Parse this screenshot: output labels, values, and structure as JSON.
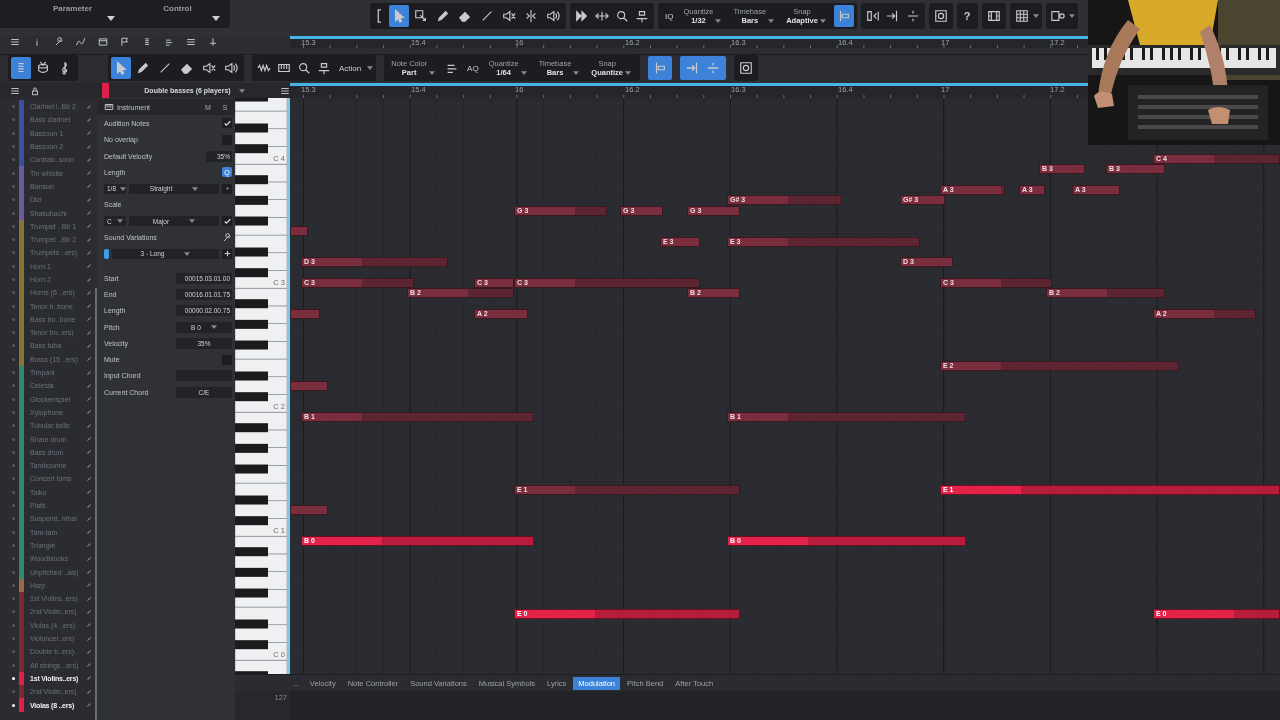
{
  "top_panel": {
    "parameter": "Parameter",
    "control": "Control"
  },
  "main_toolbar": {
    "tools": [
      {
        "selected": true
      },
      {
        "selected": false
      },
      {
        "selected": false
      },
      {
        "selected": false
      },
      {
        "selected": false
      },
      {
        "selected": false
      },
      {
        "selected": false
      },
      {
        "selected": false
      }
    ],
    "iq": "IQ",
    "quantize": {
      "label": "Quantize",
      "value": "1/32"
    },
    "timebase": {
      "label": "Timebase",
      "value": "Bars"
    },
    "snap": {
      "label": "Snap",
      "value": "Adaptive"
    },
    "snap_on": true,
    "help": "?"
  },
  "ruler_top": {
    "ticks": [
      "15.3",
      "15.4",
      "16",
      "16.2",
      "16.3",
      "16.4",
      "17",
      "17.2"
    ]
  },
  "editor_toolbar": {
    "views": [
      {
        "selected": true
      },
      {
        "selected": false
      },
      {
        "selected": false
      }
    ],
    "tools": [
      {
        "selected": true
      },
      {
        "selected": false
      },
      {
        "selected": false
      },
      {
        "selected": false
      },
      {
        "selected": false
      },
      {
        "selected": false
      }
    ],
    "action": "Action",
    "note_color": {
      "label": "Note Color",
      "value": "Part"
    },
    "aq": "AQ",
    "quantize": {
      "label": "Quantize",
      "value": "1/64"
    },
    "timebase": {
      "label": "Timebase",
      "value": "Bars"
    },
    "snap": {
      "label": "Snap",
      "value": "Quantize"
    },
    "snap_on": true,
    "step_on": true
  },
  "ruler": {
    "ticks": [
      "15.3",
      "15.4",
      "16",
      "16.2",
      "16.3",
      "16.4",
      "17",
      "17.2"
    ]
  },
  "tracks": [
    {
      "name": "Clarinet i..Bb 2",
      "color": "#3b4f9e",
      "selected": false
    },
    {
      "name": "Bass clarinet",
      "color": "#3b4f9e",
      "selected": false
    },
    {
      "name": "Bassoon 1",
      "color": "#3b4f9e",
      "selected": false
    },
    {
      "name": "Bassoon 2",
      "color": "#3b4f9e",
      "selected": false
    },
    {
      "name": "Contrab..soon",
      "color": "#3b4f9e",
      "selected": false
    },
    {
      "name": "Tin whistle",
      "color": "#6b5a9c",
      "selected": false
    },
    {
      "name": "Bansuri",
      "color": "#6b5a9c",
      "selected": false
    },
    {
      "name": "Dizi",
      "color": "#6b5a9c",
      "selected": false
    },
    {
      "name": "Shakuhachi",
      "color": "#6b5a9c",
      "selected": false
    },
    {
      "name": "Trumpet ..Bb 1",
      "color": "#857638",
      "selected": false
    },
    {
      "name": "Trumpet ..Bb 2",
      "color": "#857638",
      "selected": false
    },
    {
      "name": "Trumpets ..ers)",
      "color": "#857638",
      "selected": false
    },
    {
      "name": "Horn 1",
      "color": "#857638",
      "selected": false
    },
    {
      "name": "Horn 2",
      "color": "#857638",
      "selected": false
    },
    {
      "name": "Horns (6 ..ers)",
      "color": "#857638",
      "selected": false
    },
    {
      "name": "Tenor tr..bone",
      "color": "#857638",
      "selected": false
    },
    {
      "name": "Bass tro..bone",
      "color": "#857638",
      "selected": false
    },
    {
      "name": "Tenor tro..ers)",
      "color": "#857638",
      "selected": false
    },
    {
      "name": "Bass tuba",
      "color": "#857638",
      "selected": false
    },
    {
      "name": "Brass (15 ..ers)",
      "color": "#857638",
      "selected": false
    },
    {
      "name": "Timpani",
      "color": "#2e8a68",
      "selected": false
    },
    {
      "name": "Celesta",
      "color": "#2e8a68",
      "selected": false
    },
    {
      "name": "Glockenspiel",
      "color": "#2e8a68",
      "selected": false
    },
    {
      "name": "Xylophone",
      "color": "#2e8a68",
      "selected": false
    },
    {
      "name": "Tubular bells",
      "color": "#2e8a68",
      "selected": false
    },
    {
      "name": "Snare drum",
      "color": "#2e8a68",
      "selected": false
    },
    {
      "name": "Bass drum",
      "color": "#2e8a68",
      "selected": false
    },
    {
      "name": "Tambourine",
      "color": "#2e8a68",
      "selected": false
    },
    {
      "name": "Concert toms",
      "color": "#2e8a68",
      "selected": false
    },
    {
      "name": "Taiko",
      "color": "#2e8a68",
      "selected": false
    },
    {
      "name": "Piatti",
      "color": "#2e8a68",
      "selected": false
    },
    {
      "name": "Suspend..mbal",
      "color": "#2e8a68",
      "selected": false
    },
    {
      "name": "Tam-tam",
      "color": "#2e8a68",
      "selected": false
    },
    {
      "name": "Triangle",
      "color": "#2e8a68",
      "selected": false
    },
    {
      "name": "Woodblocks",
      "color": "#2e8a68",
      "selected": false
    },
    {
      "name": "Unpitched ..als)",
      "color": "#2e8a68",
      "selected": false
    },
    {
      "name": "Harp",
      "color": "#9a6a48",
      "selected": false
    },
    {
      "name": "1st Violins..ers)",
      "color": "#7c2537",
      "selected": false
    },
    {
      "name": "2nd Violin..ers)",
      "color": "#7c2537",
      "selected": false
    },
    {
      "name": "Violas (4 ..ers)",
      "color": "#7c2537",
      "selected": false
    },
    {
      "name": "Violoncel..ers)",
      "color": "#7c2537",
      "selected": false
    },
    {
      "name": "Double b..ers)",
      "color": "#7c2537",
      "selected": false
    },
    {
      "name": "All strings ..ers)",
      "color": "#7c2537",
      "selected": false
    },
    {
      "name": "1st Violins..ers)",
      "color": "#e01e4a",
      "selected": true
    },
    {
      "name": "2nd Violin..ers)",
      "color": "#7c2537",
      "selected": false
    },
    {
      "name": "Violas (8 ..ers)",
      "color": "#e01e4a",
      "selected": true
    }
  ],
  "inspector": {
    "title": "Double basses (6 players)",
    "instrument": {
      "label": "Instrument",
      "mute": "M",
      "solo": "S"
    },
    "audition": {
      "label": "Audition Notes",
      "checked": true
    },
    "no_overlap": {
      "label": "No overlap",
      "checked": false
    },
    "default_velocity": {
      "label": "Default Velocity",
      "value": "35%"
    },
    "length": {
      "label": "Length",
      "quantize_button": "Q",
      "quantize_on": true,
      "value": "1/8",
      "mode": "Straight"
    },
    "scale": {
      "label": "Scale",
      "root": "C",
      "type": "Major",
      "checked": true
    },
    "sound_variations": {
      "label": "Sound Variations",
      "value": "3 - Long"
    },
    "note_fields": [
      {
        "kind": "field",
        "label": "Start",
        "value": "00015.03.01.00"
      },
      {
        "kind": "field",
        "label": "End",
        "value": "00016.01.01.75"
      },
      {
        "kind": "field",
        "label": "Length",
        "value": "00000.02.00.75"
      },
      {
        "kind": "dropdown",
        "label": "Pitch",
        "value": "B 0"
      },
      {
        "kind": "center",
        "label": "Velocity",
        "value": "35%"
      },
      {
        "kind": "check",
        "label": "Mute",
        "checked": false
      },
      {
        "kind": "field",
        "label": "Input Chord"
      },
      {
        "kind": "center",
        "label": "Current Chord",
        "value": "C/E"
      }
    ]
  },
  "keyboard": {
    "octaves": [
      "C 4",
      "C 3",
      "C 2",
      "C 1",
      "C 0"
    ]
  },
  "notes": [
    {
      "label": "C 4",
      "selected": false
    },
    {
      "label": "B 3",
      "selected": false
    },
    {
      "label": "B 3",
      "selected": false
    },
    {
      "label": "A 3",
      "selected": false
    },
    {
      "label": "A 3",
      "selected": false
    },
    {
      "label": "A 3",
      "selected": false
    },
    {
      "label": "G# 3",
      "selected": false
    },
    {
      "label": "G# 3",
      "selected": false
    },
    {
      "label": "G 3",
      "selected": false
    },
    {
      "label": "G 3",
      "selected": false
    },
    {
      "label": "G 3",
      "selected": false
    },
    {
      "label": "E 3",
      "selected": false
    },
    {
      "label": "E 3",
      "selected": false
    },
    {
      "label": "D 3",
      "selected": false
    },
    {
      "label": "D 3",
      "selected": false
    },
    {
      "label": "C 3",
      "selected": false
    },
    {
      "label": "C 3",
      "selected": false
    },
    {
      "label": "C 3",
      "selected": false
    },
    {
      "label": "C 3",
      "selected": false
    },
    {
      "label": "B 2",
      "selected": false
    },
    {
      "label": "B 2",
      "selected": false
    },
    {
      "label": "B 2",
      "selected": false
    },
    {
      "label": "A 2",
      "selected": false
    },
    {
      "label": "A 2",
      "selected": false
    },
    {
      "label": "E 2",
      "selected": false
    },
    {
      "label": "B 1",
      "selected": false
    },
    {
      "label": "B 1",
      "selected": false
    },
    {
      "label": "E 1",
      "selected": false
    },
    {
      "label": "E 1",
      "selected": true
    },
    {
      "label": "B 0",
      "selected": true
    },
    {
      "label": "B 0",
      "selected": true
    },
    {
      "label": "E 0",
      "selected": true
    },
    {
      "label": "E 0",
      "selected": true
    }
  ],
  "lanes": {
    "more": "...",
    "tabs": [
      {
        "label": "Velocity",
        "selected": false
      },
      {
        "label": "Note Controller",
        "selected": false
      },
      {
        "label": "Sound Variations",
        "selected": false
      },
      {
        "label": "Musical Symbols",
        "selected": false
      },
      {
        "label": "Lyrics",
        "selected": false
      },
      {
        "label": "Modulation",
        "selected": true
      },
      {
        "label": "Pitch Bend",
        "selected": false
      },
      {
        "label": "After Touch",
        "selected": false
      }
    ],
    "max": "127"
  }
}
